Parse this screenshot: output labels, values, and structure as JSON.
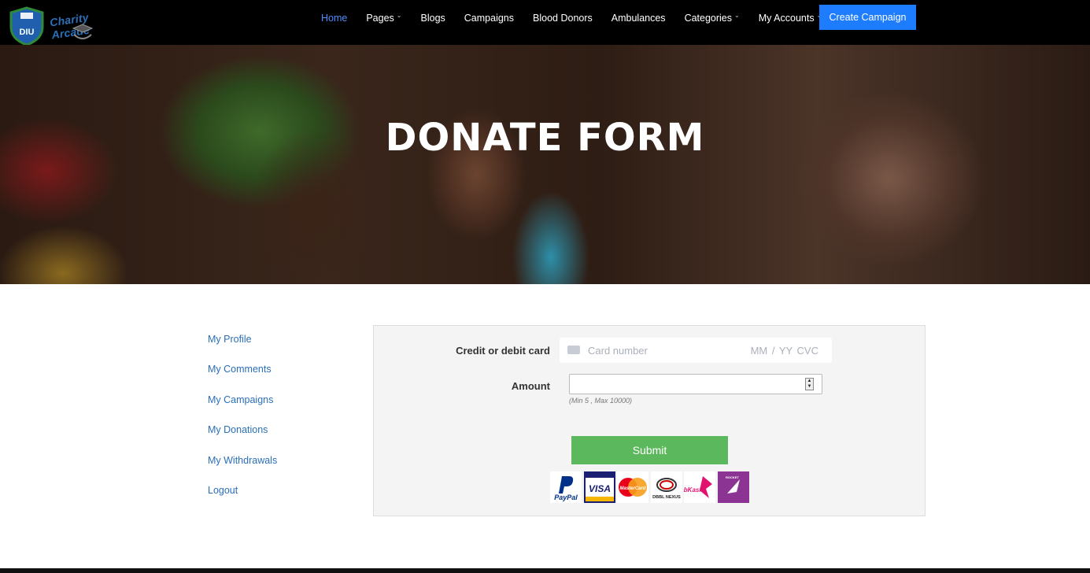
{
  "brand": {
    "name": "Charity Arcade",
    "emblem_text": "DIU"
  },
  "nav": {
    "items": [
      {
        "label": "Home",
        "active": true,
        "dropdown": false
      },
      {
        "label": "Pages",
        "active": false,
        "dropdown": true
      },
      {
        "label": "Blogs",
        "active": false,
        "dropdown": false
      },
      {
        "label": "Campaigns",
        "active": false,
        "dropdown": false
      },
      {
        "label": "Blood Donors",
        "active": false,
        "dropdown": false
      },
      {
        "label": "Ambulances",
        "active": false,
        "dropdown": false
      },
      {
        "label": "Categories",
        "active": false,
        "dropdown": true
      },
      {
        "label": "My Accounts",
        "active": false,
        "dropdown": true
      }
    ],
    "cta_label": "Create Campaign"
  },
  "hero": {
    "title": "DONATE FORM"
  },
  "sidebar": {
    "links": [
      "My Profile",
      "My Comments",
      "My Campaigns",
      "My Donations",
      "My Withdrawals",
      "Logout"
    ]
  },
  "form": {
    "card_label": "Credit or debit card",
    "card_placeholder": "Card number",
    "card_exp_placeholder": "MM / YY  CVC",
    "amount_label": "Amount",
    "amount_value": "",
    "amount_hint": "(Min 5 , Max 10000)",
    "submit_label": "Submit"
  },
  "payment_methods": [
    "PayPal",
    "VISA",
    "MasterCard",
    "DBBL NEXUS",
    "bKash",
    "ROCKET"
  ],
  "colors": {
    "nav_bg": "#000000",
    "accent": "#1e7dff",
    "active_link": "#4d8dff",
    "submit": "#5cb85c",
    "sidebar_link": "#2a6fb8"
  }
}
